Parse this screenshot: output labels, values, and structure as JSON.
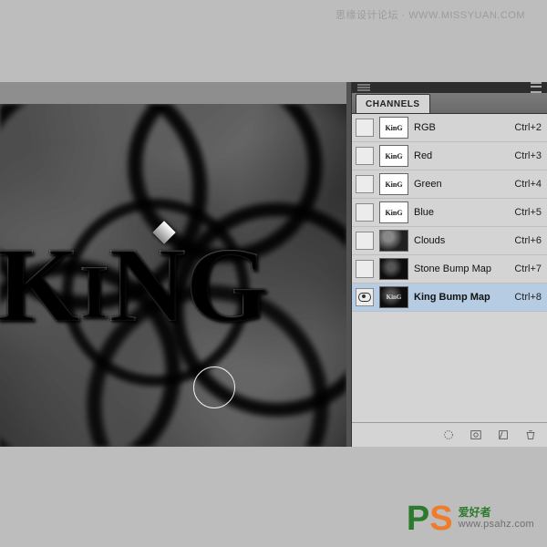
{
  "watermark_top": "思缘设计论坛  ·  WWW.MISSYUAN.COM",
  "canvas_text": "KinG",
  "panel": {
    "tab": "CHANNELS",
    "rows": [
      {
        "thumb": "KinG",
        "name": "RGB",
        "shortcut": "Ctrl+2",
        "visible": false,
        "tex": ""
      },
      {
        "thumb": "KinG",
        "name": "Red",
        "shortcut": "Ctrl+3",
        "visible": false,
        "tex": ""
      },
      {
        "thumb": "KinG",
        "name": "Green",
        "shortcut": "Ctrl+4",
        "visible": false,
        "tex": ""
      },
      {
        "thumb": "KinG",
        "name": "Blue",
        "shortcut": "Ctrl+5",
        "visible": false,
        "tex": ""
      },
      {
        "thumb": "",
        "name": "Clouds",
        "shortcut": "Ctrl+6",
        "visible": false,
        "tex": "tex"
      },
      {
        "thumb": "",
        "name": "Stone Bump Map",
        "shortcut": "Ctrl+7",
        "visible": false,
        "tex": "tex2"
      },
      {
        "thumb": "KinG",
        "name": "King Bump Map",
        "shortcut": "Ctrl+8",
        "visible": true,
        "tex": "tex2",
        "selected": true
      }
    ]
  },
  "bottom": {
    "brand_cn": "爱好者",
    "url": "www.psahz.com"
  }
}
